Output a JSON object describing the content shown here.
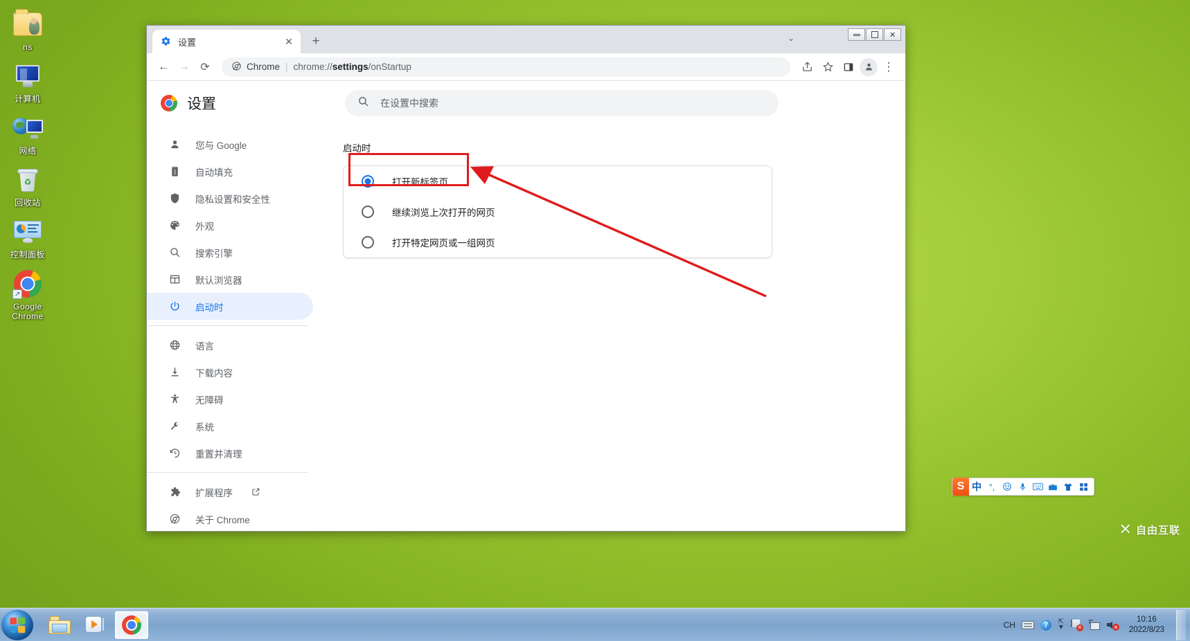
{
  "desktop": {
    "icons": [
      {
        "label": "ns",
        "icon": "user-folder-icon"
      },
      {
        "label": "计算机",
        "icon": "computer-icon"
      },
      {
        "label": "网络",
        "icon": "network-icon"
      },
      {
        "label": "回收站",
        "icon": "recycle-bin-icon"
      },
      {
        "label": "控制面板",
        "icon": "control-panel-icon"
      },
      {
        "label": "Google Chrome",
        "icon": "chrome-shortcut-icon"
      }
    ]
  },
  "browser": {
    "tab": {
      "title": "设置",
      "favicon": "gear-icon",
      "close_label": "✕"
    },
    "new_tab_label": "+",
    "tabstrip_menu_label": "⌄",
    "window_controls": {
      "minimize": "—",
      "restore": "❐",
      "close": "✕"
    },
    "toolbar": {
      "back_label": "←",
      "forward_label": "→",
      "reload_label": "⟳",
      "omnibox_chip": "Chrome",
      "omnibox_separator": "|",
      "omnibox_url_prefix": "chrome://",
      "omnibox_url_bold": "settings",
      "omnibox_url_suffix": "/onStartup",
      "share_label": "share-icon",
      "bookmark_label": "★",
      "sidepanel_label": "side-panel-icon",
      "profile_label": "profile-icon",
      "menu_label": "⋮"
    }
  },
  "settings": {
    "brand_title": "设置",
    "search": {
      "placeholder": "在设置中搜索",
      "icon": "search-icon"
    },
    "nav_groups": [
      {
        "items": [
          {
            "label": "您与 Google",
            "icon": "person-icon",
            "active": false
          },
          {
            "label": "自动填充",
            "icon": "clipboard-icon",
            "active": false
          },
          {
            "label": "隐私设置和安全性",
            "icon": "shield-icon",
            "active": false
          },
          {
            "label": "外观",
            "icon": "palette-icon",
            "active": false
          },
          {
            "label": "搜索引擎",
            "icon": "search-icon",
            "active": false
          },
          {
            "label": "默认浏览器",
            "icon": "browser-window-icon",
            "active": false
          },
          {
            "label": "启动时",
            "icon": "power-icon",
            "active": true
          }
        ]
      },
      {
        "items": [
          {
            "label": "语言",
            "icon": "globe-icon",
            "active": false
          },
          {
            "label": "下载内容",
            "icon": "download-icon",
            "active": false
          },
          {
            "label": "无障碍",
            "icon": "accessibility-icon",
            "active": false
          },
          {
            "label": "系统",
            "icon": "wrench-icon",
            "active": false
          },
          {
            "label": "重置并清理",
            "icon": "history-restore-icon",
            "active": false
          }
        ]
      },
      {
        "items": [
          {
            "label": "扩展程序",
            "icon": "puzzle-icon",
            "active": false,
            "external": true
          },
          {
            "label": "关于 Chrome",
            "icon": "chrome-outline-icon",
            "active": false
          }
        ]
      }
    ],
    "section": {
      "title": "启动时",
      "options": [
        {
          "label": "打开新标签页",
          "checked": true
        },
        {
          "label": "继续浏览上次打开的网页",
          "checked": false
        },
        {
          "label": "打开特定网页或一组网页",
          "checked": false
        }
      ]
    }
  },
  "annotation": {
    "highlight_color": "#e01b1b",
    "arrow_color": "#e01b1b",
    "target_option_index": 0
  },
  "ime": {
    "logo": "S",
    "items": [
      {
        "icon": "chinese-mode-icon",
        "label": "中"
      },
      {
        "icon": "punctuation-icon",
        "label": "°,"
      },
      {
        "icon": "emoji-icon",
        "label": "☺"
      },
      {
        "icon": "microphone-icon",
        "label": "🎤"
      },
      {
        "icon": "keyboard-icon",
        "label": "⌨"
      },
      {
        "icon": "toolbox-icon",
        "label": "🧰"
      },
      {
        "icon": "skin-icon",
        "label": "👕"
      },
      {
        "icon": "apps-grid-icon",
        "label": "▦"
      }
    ]
  },
  "taskbar": {
    "start_label": "start-orb-icon",
    "pinned": [
      {
        "icon": "file-explorer-icon",
        "active": false
      },
      {
        "icon": "media-player-icon",
        "active": false
      },
      {
        "icon": "chrome-icon",
        "active": true
      }
    ],
    "tray": {
      "language": "CH",
      "keyboard_icon": "keyboard-icon",
      "help_icon": "help-icon",
      "updown_icon": "show-hidden-icons-icon",
      "flag_icon": "action-center-flag-icon",
      "network_icon": "network-status-icon",
      "volume_icon": "volume-muted-icon",
      "time": "10:16",
      "date": "2022/8/23"
    }
  },
  "watermark": {
    "mark": "✕",
    "text": "自由互联"
  }
}
